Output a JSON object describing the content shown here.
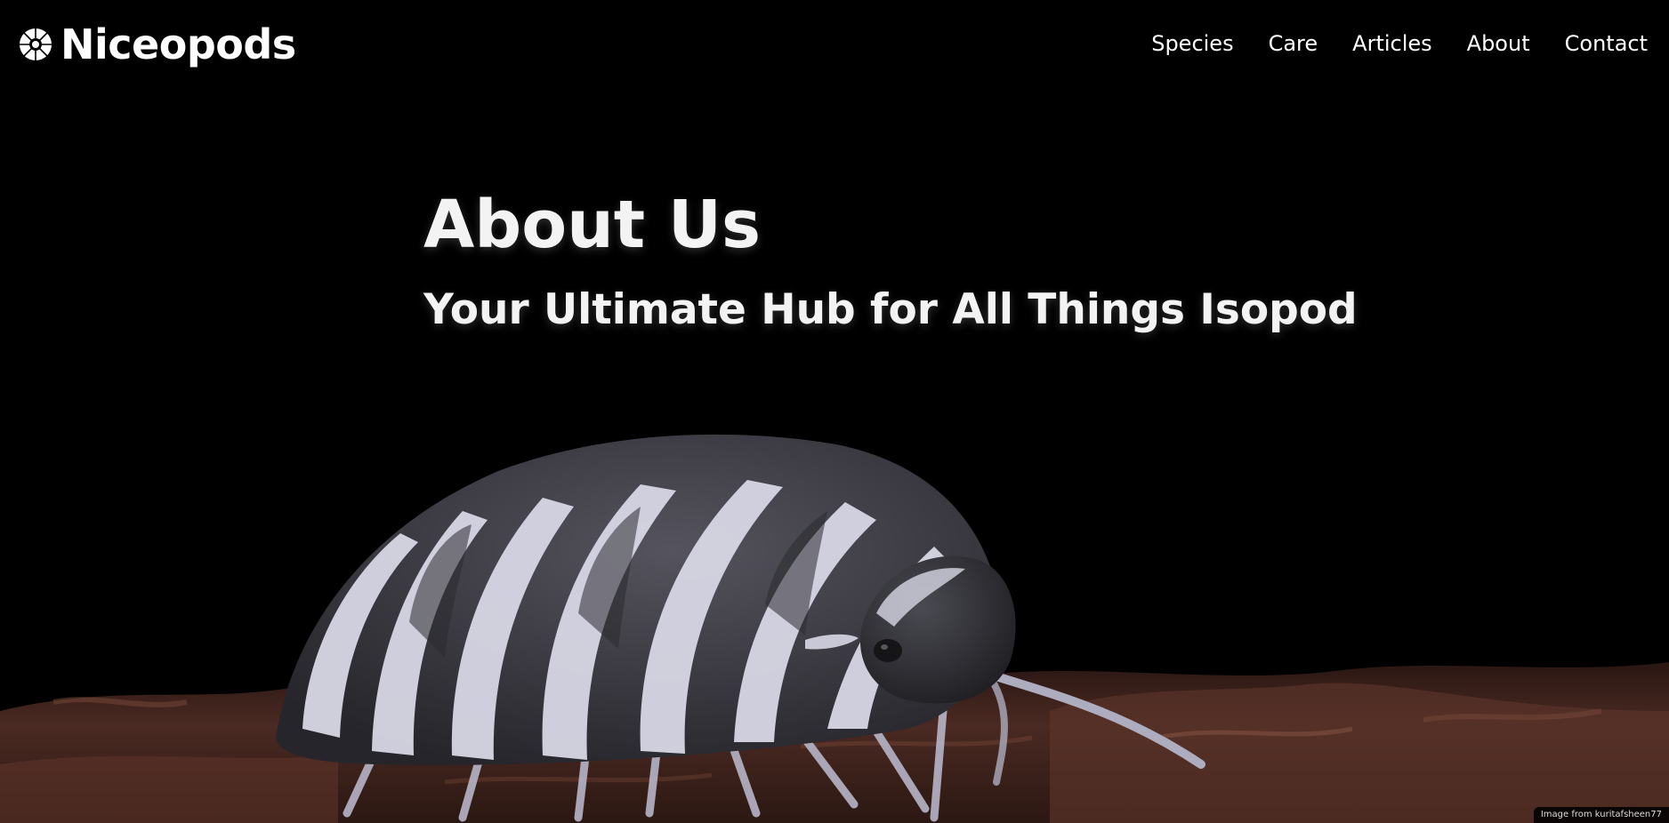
{
  "header": {
    "logo_icon": "isopod-spiral-icon",
    "brand": "Niceopods",
    "nav": [
      {
        "label": "Species"
      },
      {
        "label": "Care"
      },
      {
        "label": "Articles"
      },
      {
        "label": "About"
      },
      {
        "label": "Contact"
      }
    ]
  },
  "hero": {
    "title": "About Us",
    "subtitle": "Your Ultimate Hub for All Things Isopod",
    "image_subject": "zebra-isopod-on-bark",
    "credit": "Image from kuritafsheen77"
  },
  "colors": {
    "background": "#000000",
    "text": "#f3f3f3",
    "bark": "#4a2a22",
    "isopod_dark": "#3b3b42",
    "isopod_light": "#d9d8e6"
  }
}
